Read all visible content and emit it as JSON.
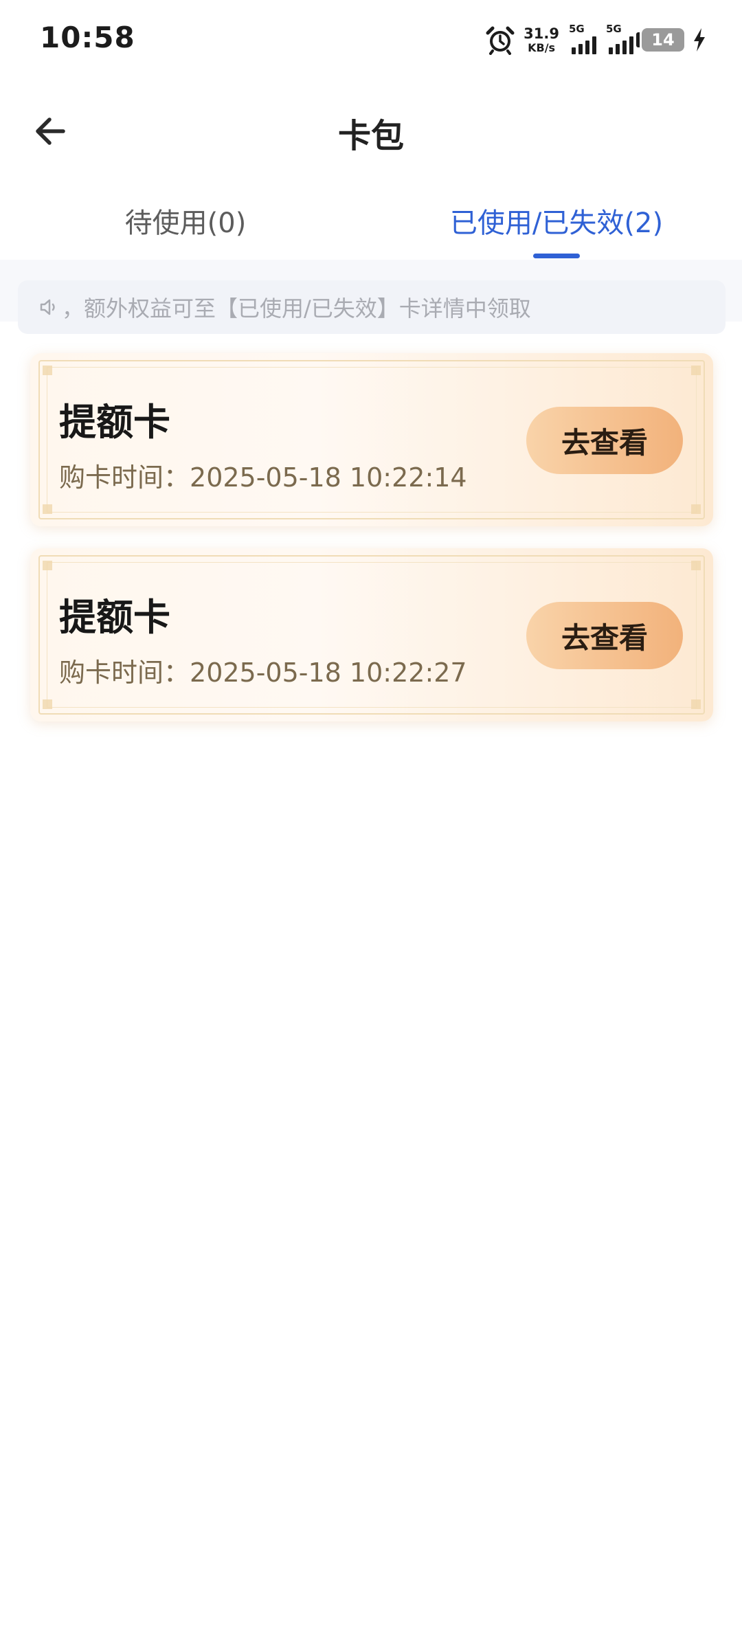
{
  "status_bar": {
    "time": "10:58",
    "net_speed": "31.9",
    "net_unit": "KB/s",
    "signal1_label": "5G",
    "signal2_label": "5G",
    "battery": "14"
  },
  "header": {
    "title": "卡包"
  },
  "tabs": [
    {
      "label": "待使用(0)",
      "active": false
    },
    {
      "label": "已使用/已失效(2)",
      "active": true
    }
  ],
  "notice": {
    "text": "，额外权益可至【已使用/已失效】卡详情中领取"
  },
  "cards": [
    {
      "name": "提额卡",
      "time_label": "购卡时间：",
      "time": "2025-05-18 10:22:14",
      "button": "去查看"
    },
    {
      "name": "提额卡",
      "time_label": "购卡时间：",
      "time": "2025-05-18 10:22:27",
      "button": "去查看"
    }
  ],
  "colors": {
    "accent": "#2f61d5",
    "button_start": "#f9d3a9",
    "button_end": "#f2b27b",
    "time_text": "#7b6a4e"
  }
}
